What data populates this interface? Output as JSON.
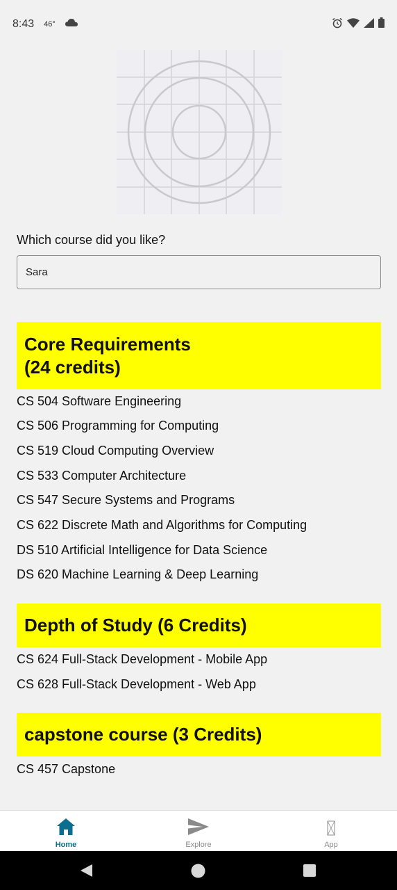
{
  "status_bar": {
    "time": "8:43",
    "temperature": "46°",
    "icons": [
      "cloud-icon",
      "alarm-icon",
      "wifi-icon",
      "signal-icon",
      "battery-icon"
    ]
  },
  "form": {
    "question": "Which course did you like?",
    "input_value": "Sara"
  },
  "sections": {
    "core": {
      "title_line1": "Core Requirements",
      "title_line2": "(24 credits)",
      "courses": [
        "CS 504 Software Engineering",
        "CS 506 Programming for Computing",
        "CS 519 Cloud Computing Overview",
        "CS 533 Computer Architecture",
        "CS 547 Secure Systems and Programs",
        "CS 622 Discrete Math and Algorithms for Computing",
        "DS 510 Artificial Intelligence for Data Science",
        "DS 620 Machine Learning & Deep Learning"
      ]
    },
    "depth": {
      "title": "Depth of Study (6 Credits)",
      "courses": [
        "CS 624 Full-Stack Development - Mobile App",
        "CS 628 Full-Stack Development - Web App"
      ]
    },
    "capstone": {
      "title": "capstone course (3 Credits)",
      "courses": [
        "CS 457 Capstone"
      ]
    }
  },
  "bottom_nav": {
    "items": [
      {
        "label": "Home",
        "icon": "home-icon",
        "active": true
      },
      {
        "label": "Explore",
        "icon": "send-icon",
        "active": false
      },
      {
        "label": "App",
        "icon": "missing-glyph-icon",
        "active": false
      }
    ]
  },
  "colors": {
    "section_header_bg": "#ffff00",
    "active_nav": "#0b6e8e",
    "inactive_nav": "#8a8a8a",
    "background": "#f2f1f2"
  }
}
